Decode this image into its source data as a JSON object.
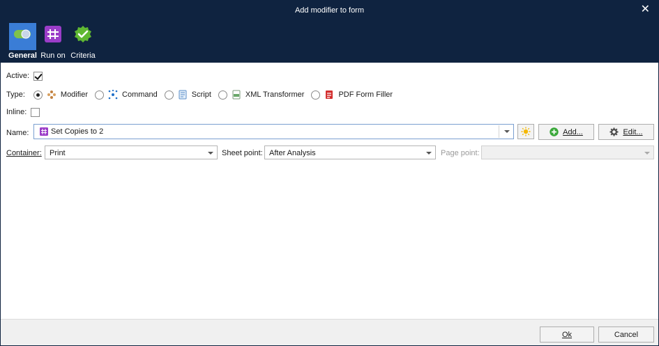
{
  "window": {
    "title": "Add modifier to form",
    "close_glyph": "✕"
  },
  "ribbon": {
    "tabs": [
      {
        "label": "General",
        "icon": "toggle-icon",
        "active": true
      },
      {
        "label": "Run on",
        "icon": "hash-icon",
        "active": false
      },
      {
        "label": "Criteria",
        "icon": "check-badge-icon",
        "active": false
      }
    ]
  },
  "form": {
    "active_label": "Active:",
    "active_checked": true,
    "type_label": "Type:",
    "types": [
      {
        "label": "Modifier",
        "icon": "modifier-icon",
        "selected": true
      },
      {
        "label": "Command",
        "icon": "command-icon",
        "selected": false
      },
      {
        "label": "Script",
        "icon": "script-icon",
        "selected": false
      },
      {
        "label": "XML Transformer",
        "icon": "xml-icon",
        "selected": false
      },
      {
        "label": "PDF Form Filler",
        "icon": "pdf-icon",
        "selected": false
      }
    ],
    "inline_label": "Inline:",
    "inline_checked": false,
    "name_label": "Name:",
    "name_value": "Set Copies to 2",
    "add_label": "Add...",
    "edit_label": "Edit...",
    "container_label": "Container:",
    "container_value": "Print",
    "sheet_point_label": "Sheet point:",
    "sheet_point_value": "After Analysis",
    "page_point_label": "Page point:",
    "page_point_value": ""
  },
  "footer": {
    "ok_label": "Ok",
    "cancel_label": "Cancel"
  },
  "colors": {
    "title_bar": "#0f2340",
    "active_tab": "#3a7dd6",
    "hash_purple": "#9b3dc8",
    "check_green": "#5fb832",
    "add_green": "#3aa83a",
    "pdf_red": "#d32f2f"
  }
}
